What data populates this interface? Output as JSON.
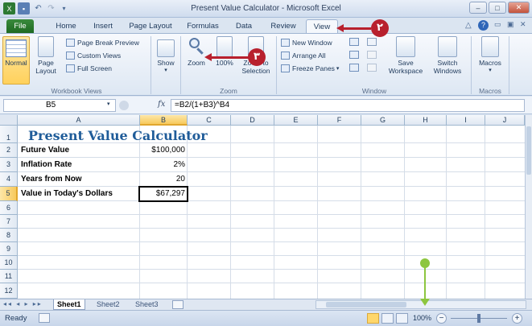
{
  "window": {
    "title": "Present Value Calculator - Microsoft Excel",
    "min_symbol": "–",
    "max_symbol": "□",
    "close_symbol": "✕"
  },
  "tabs": [
    {
      "label": "File"
    },
    {
      "label": "Home"
    },
    {
      "label": "Insert"
    },
    {
      "label": "Page Layout"
    },
    {
      "label": "Formulas"
    },
    {
      "label": "Data"
    },
    {
      "label": "Review"
    },
    {
      "label": "View"
    }
  ],
  "ribbon": {
    "workbook_views": {
      "group_label": "Workbook Views",
      "normal": "Normal",
      "page_layout_1": "Page",
      "page_layout_2": "Layout",
      "page_break_preview": "Page Break Preview",
      "custom_views": "Custom Views",
      "full_screen": "Full Screen"
    },
    "show": {
      "label": "Show"
    },
    "zoom": {
      "group_label": "Zoom",
      "zoom": "Zoom",
      "hundred": "100%",
      "zoom_to_1": "Zoom to",
      "zoom_to_2": "Selection"
    },
    "window": {
      "group_label": "Window",
      "new_window": "New Window",
      "arrange_all": "Arrange All",
      "freeze_panes": "Freeze Panes",
      "save_1": "Save",
      "save_2": "Workspace",
      "switch_1": "Switch",
      "switch_2": "Windows"
    },
    "macros": {
      "group_label": "Macros",
      "label": "Macros"
    }
  },
  "formula_bar": {
    "name_box": "B5",
    "fx": "fx",
    "formula": "=B2/(1+B3)^B4"
  },
  "columns": [
    "A",
    "B",
    "C",
    "D",
    "E",
    "F",
    "G",
    "H",
    "I",
    "J"
  ],
  "rows": [
    "1",
    "2",
    "3",
    "4",
    "5",
    "6",
    "7",
    "8",
    "9",
    "10",
    "11",
    "12"
  ],
  "cells": {
    "a1": "Present Value Calculator",
    "a2": "Future Value",
    "b2": "$100,000",
    "a3": "Inflation Rate",
    "b3": "2%",
    "a4": "Years from Now",
    "b4": "20",
    "a5": "Value in Today's Dollars",
    "b5": "$67,297"
  },
  "sheets": [
    "Sheet1",
    "Sheet2",
    "Sheet3"
  ],
  "status": {
    "ready": "Ready",
    "zoom_level": "100%",
    "zoom_out": "−",
    "zoom_in": "+"
  },
  "callouts": {
    "step_two": "٢",
    "step_three": "٣"
  },
  "colors": {
    "callout": "#b8202d",
    "zoom_arrow": "#8dc63f",
    "title_text": "#1f5c99"
  }
}
